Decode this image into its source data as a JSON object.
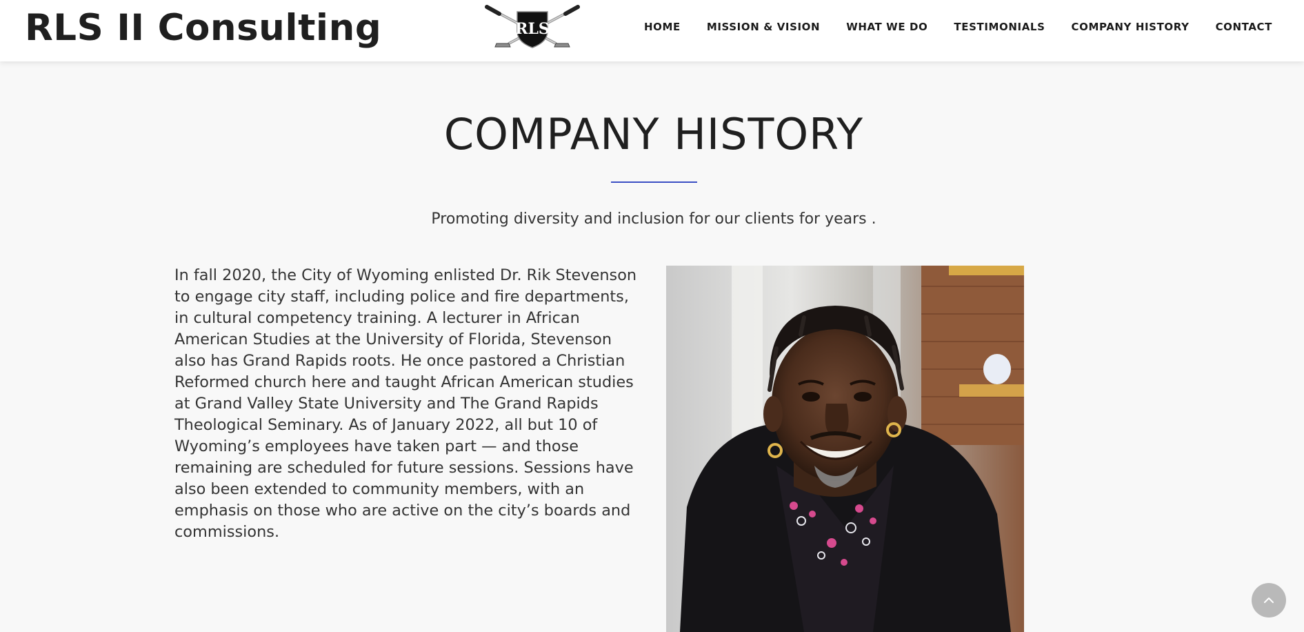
{
  "header": {
    "brand": "RLS II Consulting",
    "logo_text": "RLS",
    "nav": [
      {
        "label": "HOME"
      },
      {
        "label": "MISSION & VISION"
      },
      {
        "label": "WHAT WE DO"
      },
      {
        "label": "TESTIMONIALS"
      },
      {
        "label": "COMPANY HISTORY"
      },
      {
        "label": "CONTACT"
      }
    ]
  },
  "main": {
    "title": "COMPANY HISTORY",
    "subtitle": "Promoting diversity and inclusion for our clients for years .",
    "body": "In fall 2020, the City of Wyoming enlisted Dr. Rik Stevenson to engage city staff, including police and fire departments, in cultural competency training. A lecturer in African American Studies at the University of Florida, Stevenson also has Grand Rapids roots. He once pastored a Christian Reformed church here and taught African American studies at Grand Valley State University and The Grand Rapids Theological Seminary. As of January 2022, all but 10 of Wyoming’s employees have taken part — and those remaining are scheduled for future sessions. Sessions have also been extended to community members, with an emphasis on those who are active on the city’s boards and commissions."
  },
  "colors": {
    "accent": "#3b4fc4",
    "background": "#f8f8f8",
    "header_bg": "#ffffff",
    "scroll_button": "#b9b9b9"
  },
  "icons": {
    "logo": "crossed-golf-clubs-shield",
    "scroll_top": "chevron-up-icon"
  }
}
